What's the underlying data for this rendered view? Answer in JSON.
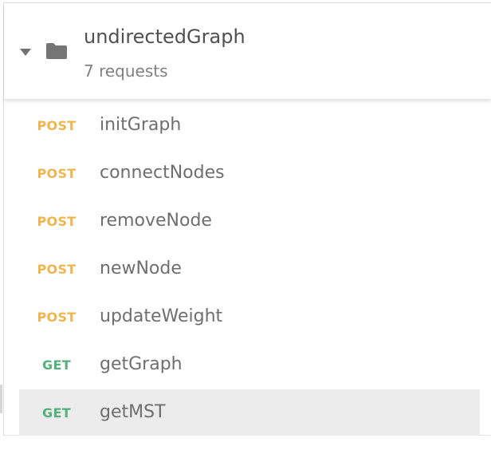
{
  "collection": {
    "name": "undirectedGraph",
    "count_label": "7 requests",
    "expanded": true,
    "icon": "folder-icon"
  },
  "requests": [
    {
      "method": "POST",
      "name": "initGraph",
      "selected": false
    },
    {
      "method": "POST",
      "name": "connectNodes",
      "selected": false
    },
    {
      "method": "POST",
      "name": "removeNode",
      "selected": false
    },
    {
      "method": "POST",
      "name": "newNode",
      "selected": false
    },
    {
      "method": "POST",
      "name": "updateWeight",
      "selected": false
    },
    {
      "method": "GET",
      "name": "getGraph",
      "selected": false
    },
    {
      "method": "GET",
      "name": "getMST",
      "selected": true
    }
  ],
  "colors": {
    "post": "#f0b54c",
    "get": "#54b078",
    "selected_bg": "#ececec",
    "text": "#6e6e6e"
  }
}
